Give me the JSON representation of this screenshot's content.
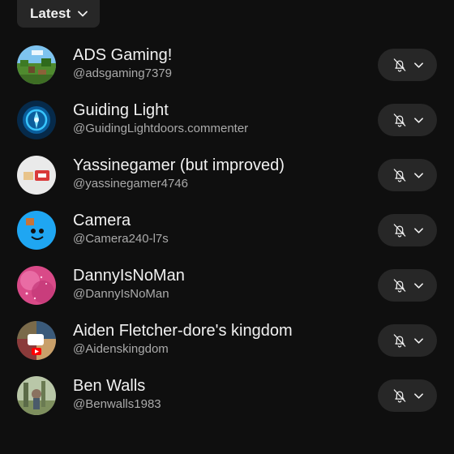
{
  "sort": {
    "label": "Latest",
    "icon": "chevron-down-icon"
  },
  "notification_button": {
    "icons": [
      "bell-off-icon",
      "chevron-down-icon"
    ]
  },
  "channels": [
    {
      "name": "ADS Gaming!",
      "handle": "@adsgaming7379",
      "avatar": "minecraft-landscape"
    },
    {
      "name": "Guiding Light",
      "handle": "@GuidingLightdoors.commenter",
      "avatar": "blue-glowing-symbol"
    },
    {
      "name": "Yassinegamer (but improved)",
      "handle": "@yassinegamer4746",
      "avatar": "white-with-red-block"
    },
    {
      "name": "Camera",
      "handle": "@Camera240-l7s",
      "avatar": "blue-cartoon-face"
    },
    {
      "name": "DannyIsNoMan",
      "handle": "@DannyIsNoMan",
      "avatar": "pink-sparkle"
    },
    {
      "name": "Aiden Fletcher-dore's kingdom",
      "handle": "@Aidenskingdom",
      "avatar": "collage-with-red-play"
    },
    {
      "name": "Ben Walls",
      "handle": "@Benwalls1983",
      "avatar": "outdoor-photo"
    }
  ]
}
